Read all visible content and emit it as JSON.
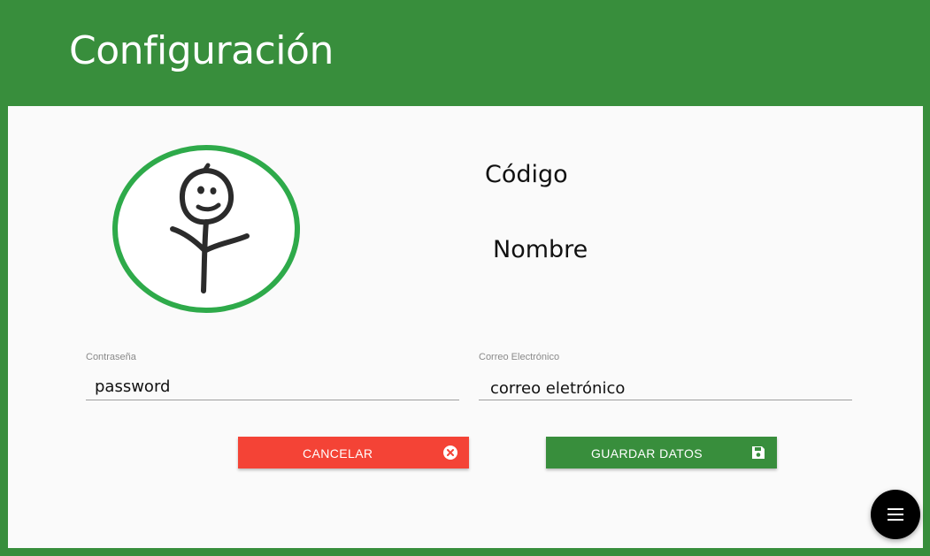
{
  "header": {
    "title": "Configuración"
  },
  "profile": {
    "code_label": "Código",
    "name_label": "Nombre",
    "avatar_icon": "stick-figure-avatar"
  },
  "form": {
    "password": {
      "label": "Contraseña",
      "value": "password"
    },
    "email": {
      "label": "Correo Electrónico",
      "value": "correo eletrónico"
    }
  },
  "buttons": {
    "cancel": {
      "label": "CANCELAR",
      "icon": "close-circle-icon",
      "color": "#f44336"
    },
    "save": {
      "label": "GUARDAR DATOS",
      "icon": "save-icon",
      "color": "#388e3c"
    }
  },
  "fab": {
    "icon": "menu-icon"
  },
  "colors": {
    "primary": "#388e3c",
    "danger": "#f44336",
    "avatar_ring": "#2eaa4a"
  }
}
